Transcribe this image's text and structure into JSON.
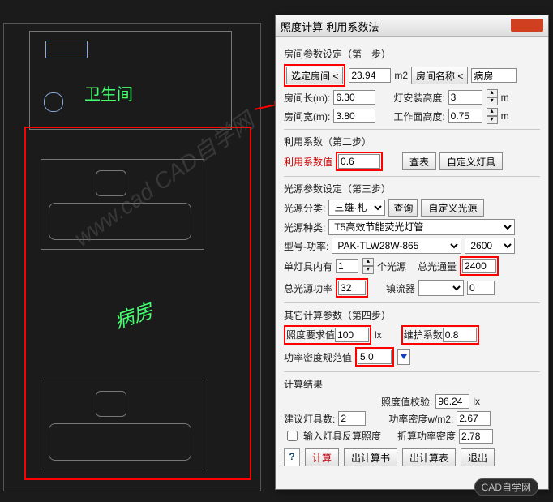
{
  "cad": {
    "room1_label": "病房",
    "room2_label": "卫生间",
    "watermark": "www.cad CAD自学网",
    "footer_badge": "CAD自学网"
  },
  "dialog": {
    "title": "照度计算-利用系数法",
    "step1": {
      "title": "房间参数设定（第一步）",
      "sel_room_btn": "选定房间 <",
      "area": "23.94",
      "area_unit": "m2",
      "room_name_btn": "房间名称 <",
      "room_name": "病房",
      "len_label": "房间长(m):",
      "len": "6.30",
      "lamp_h_label": "灯安装高度:",
      "lamp_h": "3",
      "lamp_h_unit": "m",
      "wid_label": "房间宽(m):",
      "wid": "3.80",
      "work_h_label": "工作面高度:",
      "work_h": "0.75",
      "work_h_unit": "m"
    },
    "step2": {
      "title": "利用系数（第二步）",
      "coef_label": "利用系数值",
      "coef": "0.6",
      "lookup_btn": "查表",
      "custom_lamp_btn": "自定义灯具"
    },
    "step3": {
      "title": "光源参数设定（第三步）",
      "cat_label": "光源分类:",
      "cat": "三雄·札",
      "query_btn": "查询",
      "custom_src_btn": "自定义光源",
      "kind_label": "光源种类:",
      "kind": "T5高效节能荧光灯管",
      "model_label": "型号-功率:",
      "model": "PAK-TLW28W-865",
      "model_power": "2600",
      "per_lamp_label": "单灯具内有",
      "per_lamp": "1",
      "per_lamp_suffix": "个光源",
      "flux_label": "总光通量",
      "flux": "2400",
      "power_label": "总光源功率",
      "power": "32",
      "ballast_label": "镇流器",
      "ballast": "0"
    },
    "step4": {
      "title": "其它计算参数（第四步）",
      "illum_req_label": "照度要求值",
      "illum_req": "100",
      "illum_unit": "lx",
      "maint_label": "维护系数",
      "maint": "0.8",
      "density_label": "功率密度规范值",
      "density": "5.0"
    },
    "result": {
      "title": "计算结果",
      "check_label": "照度值校验:",
      "check": "96.24",
      "check_unit": "lx",
      "suggest_label": "建议灯具数:",
      "suggest": "2",
      "pd_label": "功率密度w/m2:",
      "pd": "2.67",
      "inverse_cb": "输入灯具反算照度",
      "conv_label": "折算功率密度",
      "conv": "2.78"
    },
    "buttons": {
      "help": "?",
      "calc": "计算",
      "out_sheet": "出计算书",
      "out_table": "出计算表",
      "exit": "退出"
    }
  }
}
